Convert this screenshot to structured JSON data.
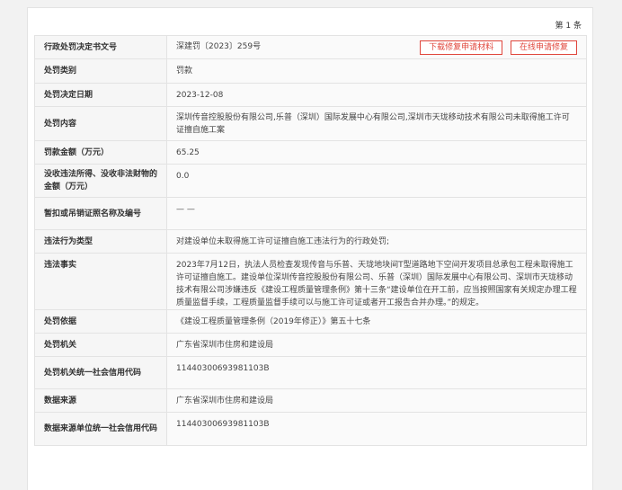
{
  "count_label": "第 1 条",
  "buttons": {
    "download": "下载修复申请材料",
    "online": "在线申请修复"
  },
  "rows": [
    {
      "label": "行政处罚决定书文号",
      "value": "深建罚〔2023〕259号"
    },
    {
      "label": "处罚类别",
      "value": "罚款"
    },
    {
      "label": "处罚决定日期",
      "value": "2023-12-08"
    },
    {
      "label": "处罚内容",
      "value": "深圳传音控股股份有限公司,乐普（深圳）国际发展中心有限公司,深圳市天珑移动技术有限公司未取得施工许可证擅自施工案"
    },
    {
      "label": "罚款金额（万元）",
      "value": "65.25"
    },
    {
      "label": "没收违法所得、没收非法财物的金额（万元）",
      "value": "0.0"
    },
    {
      "label": "暂扣或吊销证照名称及编号",
      "value": "— —"
    },
    {
      "label": "违法行为类型",
      "value": "对建设单位未取得施工许可证擅自施工违法行为的行政处罚;"
    },
    {
      "label": "违法事实",
      "value": "2023年7月12日，执法人员检查发现传音与乐普、天珑地块间T型道路地下空间开发项目总承包工程未取得施工许可证擅自施工。建设单位深圳传音控股股份有限公司、乐普（深圳）国际发展中心有限公司、深圳市天珑移动技术有限公司涉嫌违反《建设工程质量管理条例》第十三条“建设单位在开工前，应当按照国家有关规定办理工程质量监督手续，工程质量监督手续可以与施工许可证或者开工报告合并办理。”的规定。"
    },
    {
      "label": "处罚依据",
      "value": "《建设工程质量管理条例（2019年修正）》第五十七条"
    },
    {
      "label": "处罚机关",
      "value": "广东省深圳市住房和建设局"
    },
    {
      "label": "处罚机关统一社会信用代码",
      "value": "11440300693981103B"
    },
    {
      "label": "数据来源",
      "value": "广东省深圳市住房和建设局"
    },
    {
      "label": "数据来源单位统一社会信用代码",
      "value": "11440300693981103B"
    }
  ]
}
